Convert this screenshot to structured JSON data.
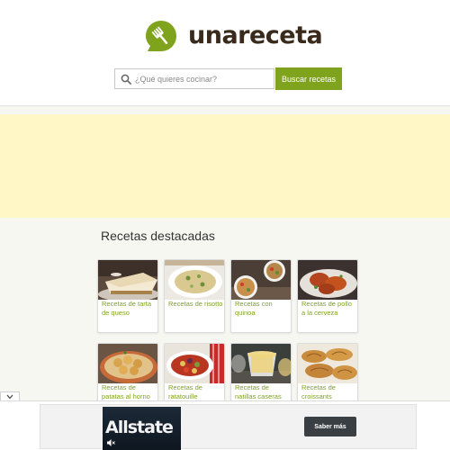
{
  "brand": {
    "name": "unareceta",
    "accent": "#7fa31c",
    "logo_icon": "fork-speech-bubble-icon"
  },
  "search": {
    "placeholder": "¿Qué quieres cocinar?",
    "value": "",
    "button_label": "Buscar recetas",
    "icon": "search-icon"
  },
  "featured": {
    "title": "Recetas destacadas",
    "recipes": [
      {
        "label": "Recetas de tarta de queso",
        "image": "cheesecake"
      },
      {
        "label": "Recetas de risotto",
        "image": "risotto"
      },
      {
        "label": "Recetas con quinoa",
        "image": "quinoa"
      },
      {
        "label": "Recetas de pollo a la cerveza",
        "image": "beer-chicken"
      },
      {
        "label": "Recetas de patatas al horno",
        "image": "baked-potatoes"
      },
      {
        "label": "Recetas de ratatouille",
        "image": "ratatouille"
      },
      {
        "label": "Recetas de natillas caseras",
        "image": "custard"
      },
      {
        "label": "Recetas de croissants",
        "image": "croissants"
      }
    ]
  },
  "bottom_ad": {
    "brand": "Allstate",
    "button_label": "Saber más",
    "mute_icon": "speaker-muted-icon"
  },
  "collapse": {
    "icon": "chevron-down-icon"
  }
}
